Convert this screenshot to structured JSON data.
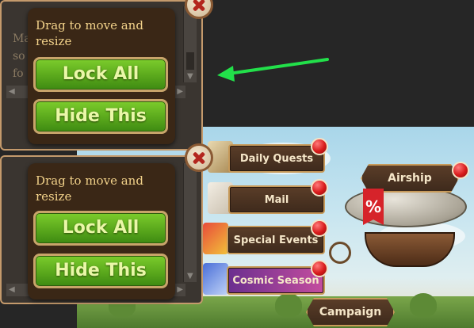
{
  "panel_top": {
    "bg_text_lines": [
      "Ma",
      "so",
      "fo"
    ],
    "popup": {
      "drag_text": "Drag to move and resize",
      "lock_label": "Lock All",
      "hide_label": "Hide This"
    }
  },
  "panel_bottom": {
    "popup": {
      "drag_text": "Drag to move and resize",
      "lock_label": "Lock All",
      "hide_label": "Hide This"
    }
  },
  "game_menu": {
    "items": [
      {
        "label": "Daily Quests",
        "icon": "quest-scroll-icon"
      },
      {
        "label": "Mail",
        "icon": "mail-envelope-icon"
      },
      {
        "label": "Special Events",
        "icon": "gift-box-icon"
      },
      {
        "label": "Cosmic Season",
        "icon": "star-crest-icon"
      }
    ],
    "airship_label": "Airship",
    "campaign_label": "Campaign",
    "sale_tag": "%"
  },
  "colors": {
    "button_green": "#5aa81c",
    "button_text": "#eaf7a8",
    "popup_text": "#f2d28a",
    "panel_border": "#c49a6c",
    "annotation_arrow": "#22e04a",
    "notification_red": "#d81b1b"
  }
}
